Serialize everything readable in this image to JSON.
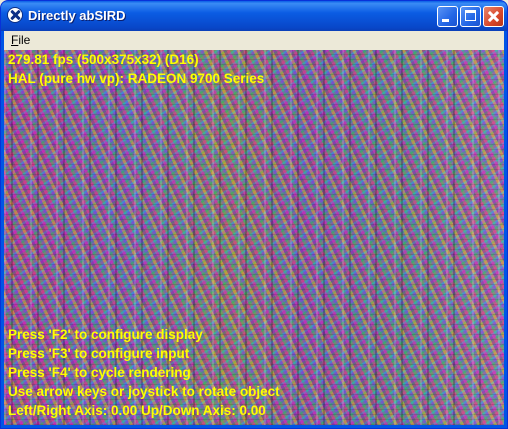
{
  "window": {
    "title": "Directly abSIRD",
    "icon": "app-icon"
  },
  "menu": {
    "items": [
      "File"
    ]
  },
  "hud": {
    "top_lines": [
      "279.81 fps (500x375x32) (D16)",
      "HAL (pure hw vp): RADEON 9700 Series"
    ],
    "bottom_lines": [
      "Press 'F2' to configure display",
      "Press 'F3' to configure input",
      "Press 'F4' to cycle rendering",
      "Use arrow keys or joystick to rotate object",
      "Left/Right Axis: 0.00 Up/Down Axis: 0.00"
    ]
  },
  "colors": {
    "titlebar": "#0a52dd",
    "hud_text": "#ffff00",
    "menubar": "#ece9d8"
  }
}
